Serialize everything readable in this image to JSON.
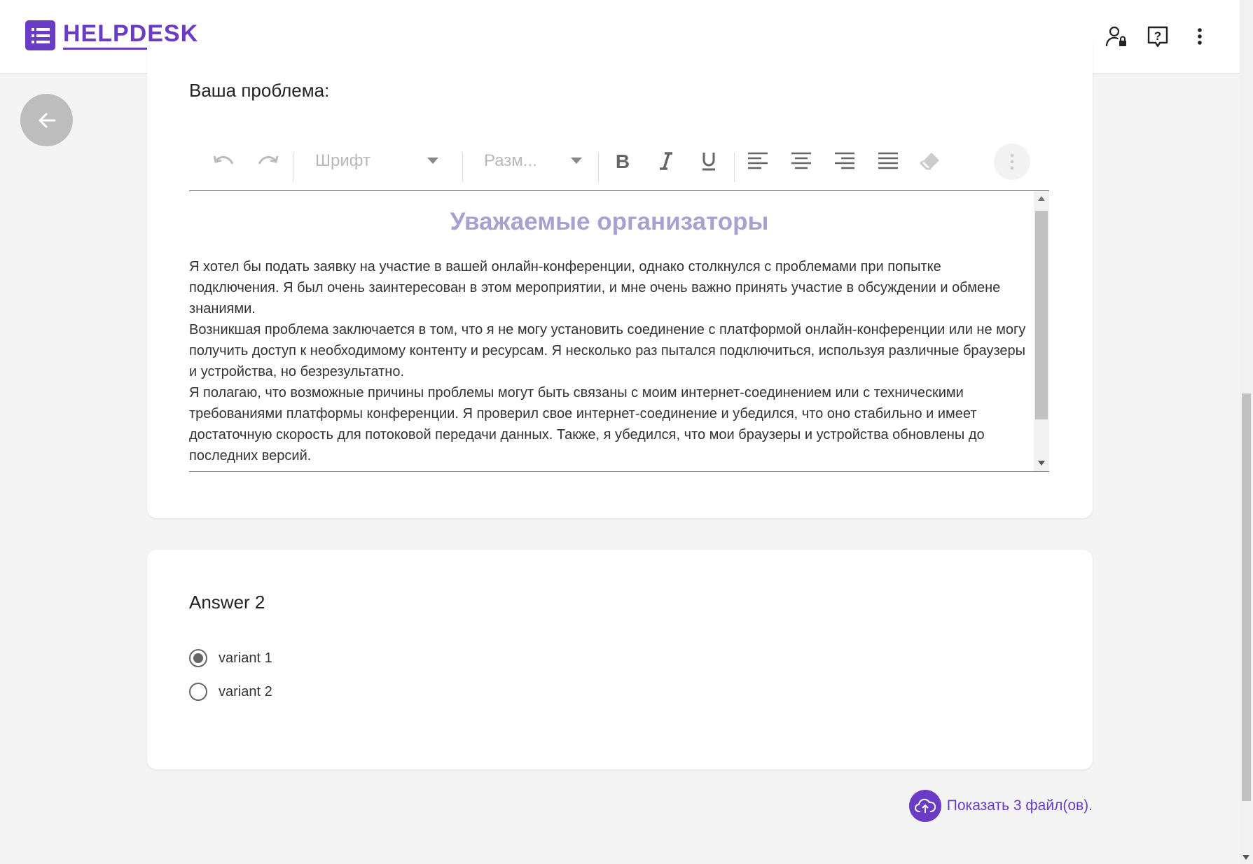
{
  "header": {
    "logo_text": "HELPDESK",
    "icons": [
      "user-lock-icon",
      "help-icon",
      "more-vert-icon"
    ]
  },
  "problem": {
    "label": "Ваша проблема:",
    "toolbar": {
      "font_placeholder": "Шрифт",
      "size_placeholder": "Разм..."
    },
    "editor": {
      "title": "Уважаемые организаторы",
      "paragraphs": [
        "Я хотел бы подать заявку на участие в вашей онлайн-конференции, однако столкнулся с проблемами при попытке подключения. Я был очень заинтересован в этом мероприятии, и мне очень важно принять участие в обсуждении и обмене знаниями.",
        "Возникшая проблема заключается в том, что я не могу установить соединение с платформой онлайн-конференции или не могу получить доступ к необходимому контенту и ресурсам. Я несколько раз пытался подключиться, используя различные браузеры и устройства, но безрезультатно.",
        "Я полагаю, что возможные причины проблемы могут быть связаны с моим интернет-соединением или с техническими требованиями платформы конференции. Я проверил свое интернет-соединение и убедился, что оно стабильно и имеет достаточную скорость для потоковой передачи данных. Также, я убедился, что мои браузеры и устройства обновлены до последних версий."
      ]
    }
  },
  "answer": {
    "title": "Answer 2",
    "options": [
      {
        "label": "variant 1",
        "selected": true
      },
      {
        "label": "variant 2",
        "selected": false
      }
    ]
  },
  "files": {
    "label": "Показать 3 файл(ов)."
  },
  "colors": {
    "accent": "#6a3bc4",
    "editor_title": "#a9a0cf"
  }
}
